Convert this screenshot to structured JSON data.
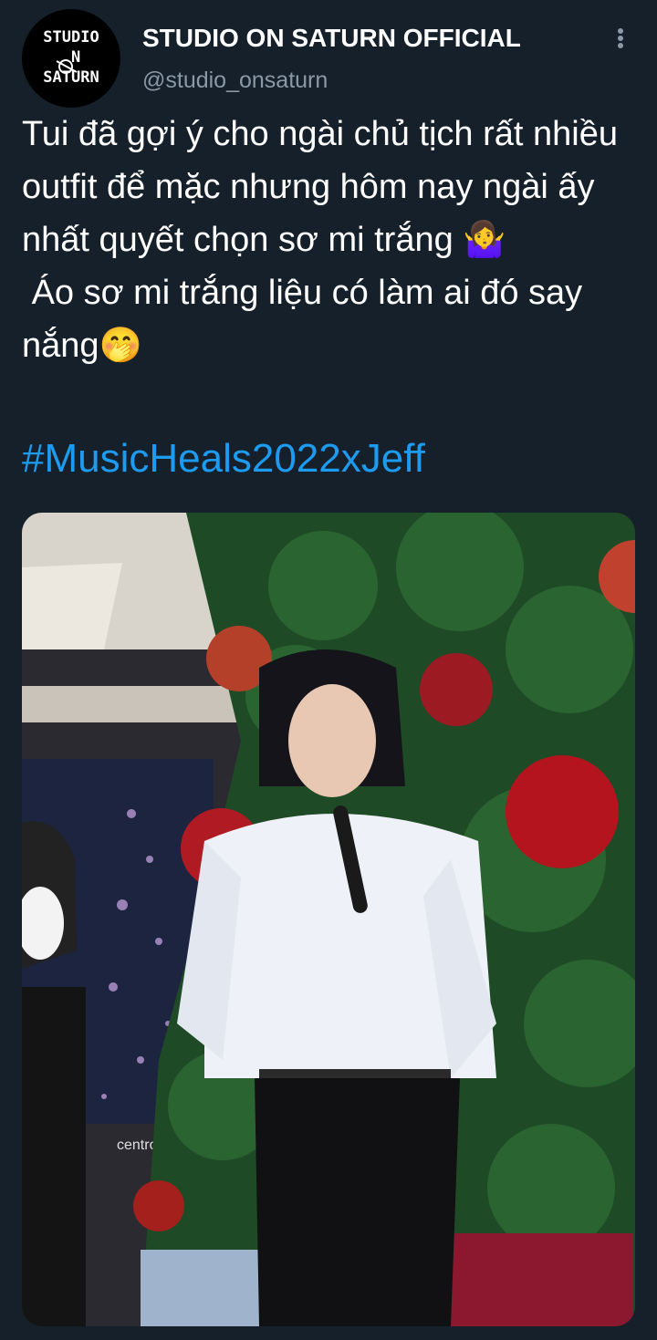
{
  "account": {
    "avatar_text": "STUDIO\n N\nSATURN",
    "display_name": "STUDIO ON SATURN OFFICIAL",
    "handle": "@studio_onsaturn"
  },
  "tweet": {
    "text": "Tui đã gợi ý cho ngài chủ tịch rất nhiều outfit để mặc nhưng hôm nay ngài ấy nhất quyết chọn sơ mi trắng 🤷‍♀️\n Áo sơ mi trắng liệu có làm ai đó say nắng🤭",
    "hashtag": "#MusicHeals2022xJeff"
  },
  "media": {
    "store_sign": "centro",
    "photo_caption": ""
  },
  "icons": {
    "more": "more-vertical-icon"
  },
  "colors": {
    "background": "#15202b",
    "text": "#ffffff",
    "secondary_text": "#8b98a5",
    "link": "#1d9bf0"
  }
}
